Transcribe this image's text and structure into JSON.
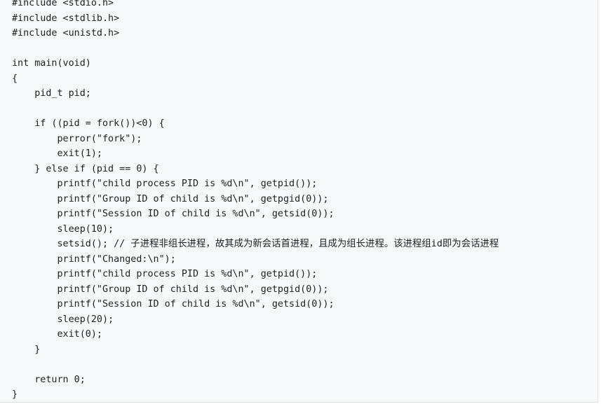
{
  "code": {
    "lines": [
      "#include <stdio.h>",
      "#include <stdlib.h>",
      "#include <unistd.h>",
      "",
      "int main(void)",
      "{",
      "    pid_t pid;",
      "",
      "    if ((pid = fork())<0) {",
      "        perror(\"fork\");",
      "        exit(1);",
      "    } else if (pid == 0) {",
      "        printf(\"child process PID is %d\\n\", getpid());",
      "        printf(\"Group ID of child is %d\\n\", getpgid(0));",
      "        printf(\"Session ID of child is %d\\n\", getsid(0));",
      "        sleep(10);",
      "        setsid(); // 子进程非组长进程，故其成为新会话首进程，且成为组长进程。该进程组id即为会话进程",
      "        printf(\"Changed:\\n\");",
      "        printf(\"child process PID is %d\\n\", getpid());",
      "        printf(\"Group ID of child is %d\\n\", getpgid(0));",
      "        printf(\"Session ID of child is %d\\n\", getsid(0));",
      "        sleep(20);",
      "        exit(0);",
      "    }",
      "",
      "    return 0;",
      "}"
    ]
  }
}
